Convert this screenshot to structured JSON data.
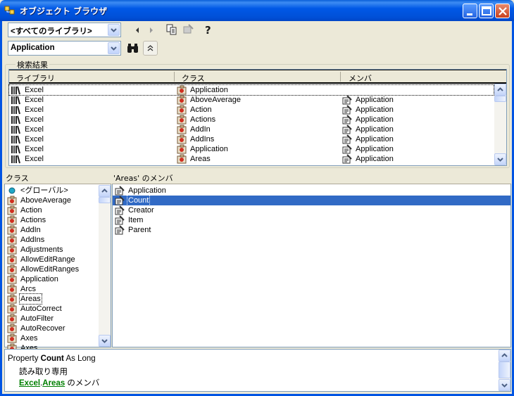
{
  "window": {
    "title": "オブジェクト ブラウザ"
  },
  "toolbar": {
    "library_combo": "<すべてのライブラリ>",
    "search_combo": "Application"
  },
  "results": {
    "group_label": "検索結果",
    "headers": [
      "ライブラリ",
      "クラス",
      "メンバ"
    ],
    "rows": [
      {
        "library": "Excel",
        "class": "Application",
        "member": ""
      },
      {
        "library": "Excel",
        "class": "AboveAverage",
        "member": "Application"
      },
      {
        "library": "Excel",
        "class": "Action",
        "member": "Application"
      },
      {
        "library": "Excel",
        "class": "Actions",
        "member": "Application"
      },
      {
        "library": "Excel",
        "class": "AddIn",
        "member": "Application"
      },
      {
        "library": "Excel",
        "class": "AddIns",
        "member": "Application"
      },
      {
        "library": "Excel",
        "class": "Application",
        "member": "Application"
      },
      {
        "library": "Excel",
        "class": "Areas",
        "member": "Application"
      }
    ]
  },
  "classes": {
    "header": "クラス",
    "items": [
      "<グローバル>",
      "AboveAverage",
      "Action",
      "Actions",
      "AddIn",
      "AddIns",
      "Adjustments",
      "AllowEditRange",
      "AllowEditRanges",
      "Application",
      "Arcs",
      "Areas",
      "AutoCorrect",
      "AutoFilter",
      "AutoRecover",
      "Axes",
      "Axes"
    ]
  },
  "members": {
    "header": "'Areas' のメンバ",
    "items": [
      "Application",
      "Count",
      "Creator",
      "Item",
      "Parent"
    ]
  },
  "detail": {
    "prefix": "Property ",
    "name": "Count",
    "suffix": " As Long",
    "readonly": "読み取り専用",
    "lib_link": "Excel",
    "dot": ".",
    "class_link": "Areas",
    "member_of": " のメンバ"
  }
}
